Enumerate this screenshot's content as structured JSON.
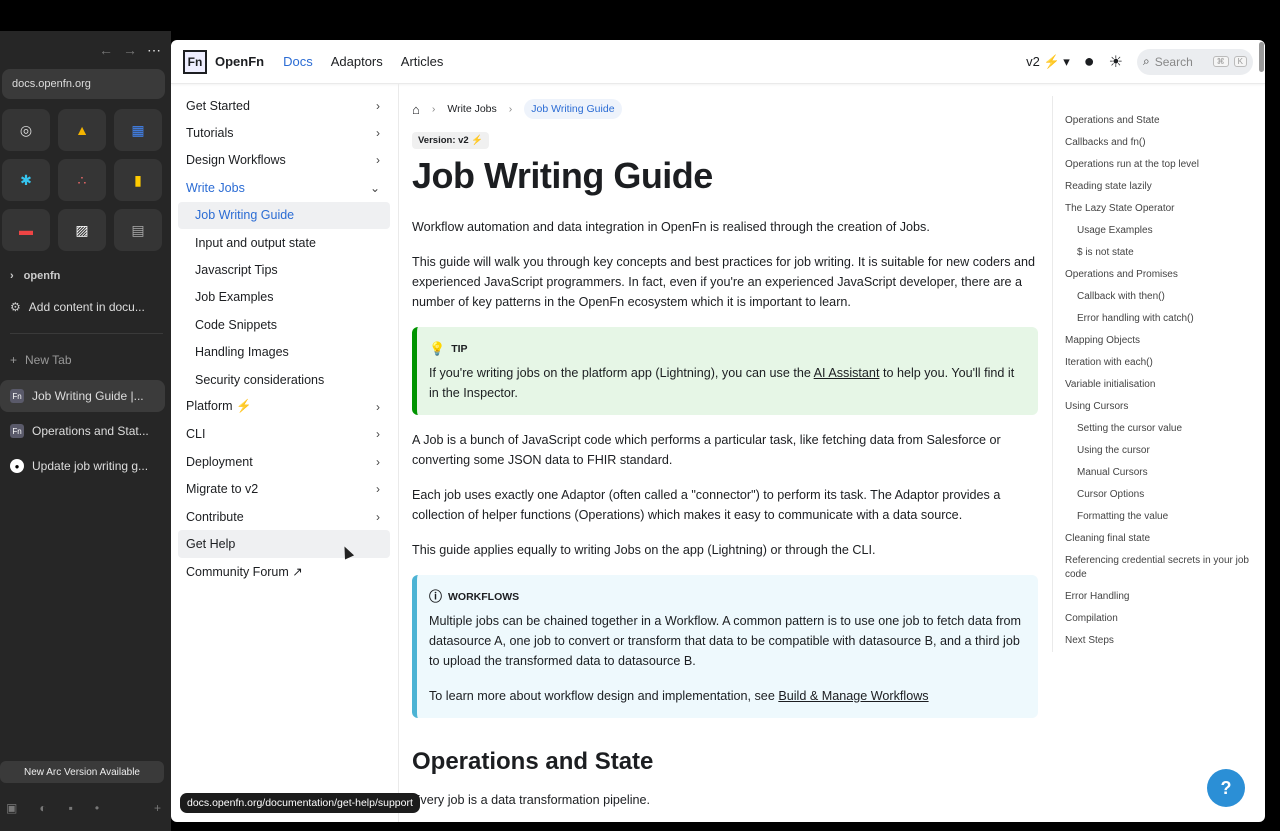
{
  "arc": {
    "url": "docs.openfn.org",
    "folder": "openfn",
    "pinned_tab": "Add content in docu...",
    "new_tab": "New Tab",
    "tabs": [
      {
        "label": "Job Writing Guide |...",
        "icon": "Fn"
      },
      {
        "label": "Operations and Stat...",
        "icon": "Fn"
      },
      {
        "label": "Update job writing g...",
        "icon": "github"
      }
    ],
    "update_banner": "New Arc Version Available"
  },
  "topbar": {
    "logo_text": "OpenFn",
    "logo_box": "Fn",
    "nav": [
      "Docs",
      "Adaptors",
      "Articles"
    ],
    "version": "v2 ⚡",
    "search_placeholder": "Search",
    "kbd1": "⌘",
    "kbd2": "K"
  },
  "sidebar": {
    "items": [
      {
        "label": "Get Started",
        "chevron": "›"
      },
      {
        "label": "Tutorials",
        "chevron": "›"
      },
      {
        "label": "Design Workflows",
        "chevron": "›"
      },
      {
        "label": "Write Jobs",
        "chevron": "⌄"
      },
      {
        "label": "Job Writing Guide"
      },
      {
        "label": "Input and output state"
      },
      {
        "label": "Javascript Tips"
      },
      {
        "label": "Job Examples"
      },
      {
        "label": "Code Snippets"
      },
      {
        "label": "Handling Images"
      },
      {
        "label": "Security considerations"
      },
      {
        "label": "Platform ⚡",
        "chevron": "›"
      },
      {
        "label": "CLI",
        "chevron": "›"
      },
      {
        "label": "Deployment",
        "chevron": "›"
      },
      {
        "label": "Migrate to v2",
        "chevron": "›"
      },
      {
        "label": "Contribute",
        "chevron": "›"
      },
      {
        "label": "Get Help"
      },
      {
        "label": "Community Forum ↗"
      }
    ]
  },
  "main": {
    "breadcrumb": [
      "Write Jobs",
      "Job Writing Guide"
    ],
    "version_badge": "Version: v2 ⚡",
    "title": "Job Writing Guide",
    "p1": "Workflow automation and data integration in OpenFn is realised through the creation of Jobs.",
    "p2": "This guide will walk you through key concepts and best practices for job writing. It is suitable for new coders and experienced JavaScript programmers. In fact, even if you're an experienced JavaScript developer, there are a number of key patterns in the OpenFn ecosystem which it is important to learn.",
    "tip_title": "TIP",
    "tip_text_a": "If you're writing jobs on the platform app (Lightning), you can use the ",
    "tip_link": "AI Assistant",
    "tip_text_b": " to help you. You'll find it in the Inspector.",
    "p3": "A Job is a bunch of JavaScript code which performs a particular task, like fetching data from Salesforce or converting some JSON data to FHIR standard.",
    "p4": "Each job uses exactly one Adaptor (often called a \"connector\") to perform its task. The Adaptor provides a collection of helper functions (Operations) which makes it easy to communicate with a data source.",
    "p5": "This guide applies equally to writing Jobs on the app (Lightning) or through the CLI.",
    "wf_title": "WORKFLOWS",
    "wf_text": "Multiple jobs can be chained together in a Workflow. A common pattern is to use one job to fetch data from datasource A, one job to convert or transform that data to be compatible with datasource B, and a third job to upload the transformed data to datasource B.",
    "wf_more_a": "To learn more about workflow design and implementation, see ",
    "wf_link": "Build & Manage Workflows",
    "h2": "Operations and State",
    "p6": "Every job is a data transformation pipeline."
  },
  "toc": [
    {
      "label": "Operations and State",
      "sub": false
    },
    {
      "label": "Callbacks and fn()",
      "sub": false
    },
    {
      "label": "Operations run at the top level",
      "sub": false
    },
    {
      "label": "Reading state lazily",
      "sub": false
    },
    {
      "label": "The Lazy State Operator",
      "sub": false
    },
    {
      "label": "Usage Examples",
      "sub": true
    },
    {
      "label": "$ is not state",
      "sub": true
    },
    {
      "label": "Operations and Promises",
      "sub": false
    },
    {
      "label": "Callback with then()",
      "sub": true
    },
    {
      "label": "Error handling with catch()",
      "sub": true
    },
    {
      "label": "Mapping Objects",
      "sub": false
    },
    {
      "label": "Iteration with each()",
      "sub": false
    },
    {
      "label": "Variable initialisation",
      "sub": false
    },
    {
      "label": "Using Cursors",
      "sub": false
    },
    {
      "label": "Setting the cursor value",
      "sub": true
    },
    {
      "label": "Using the cursor",
      "sub": true
    },
    {
      "label": "Manual Cursors",
      "sub": true
    },
    {
      "label": "Cursor Options",
      "sub": true
    },
    {
      "label": "Formatting the value",
      "sub": true
    },
    {
      "label": "Cleaning final state",
      "sub": false
    },
    {
      "label": "Referencing credential secrets in your job code",
      "sub": false
    },
    {
      "label": "Error Handling",
      "sub": false
    },
    {
      "label": "Compilation",
      "sub": false
    },
    {
      "label": "Next Steps",
      "sub": false
    }
  ],
  "status_url": "docs.openfn.org/documentation/get-help/support",
  "help_button": "?",
  "colors": {
    "accent": "#2b6cd4",
    "tip_bg": "#e6f6e6",
    "tip_border": "#009400",
    "info_bg": "#eef9fd",
    "info_border": "#4cb3d4"
  }
}
